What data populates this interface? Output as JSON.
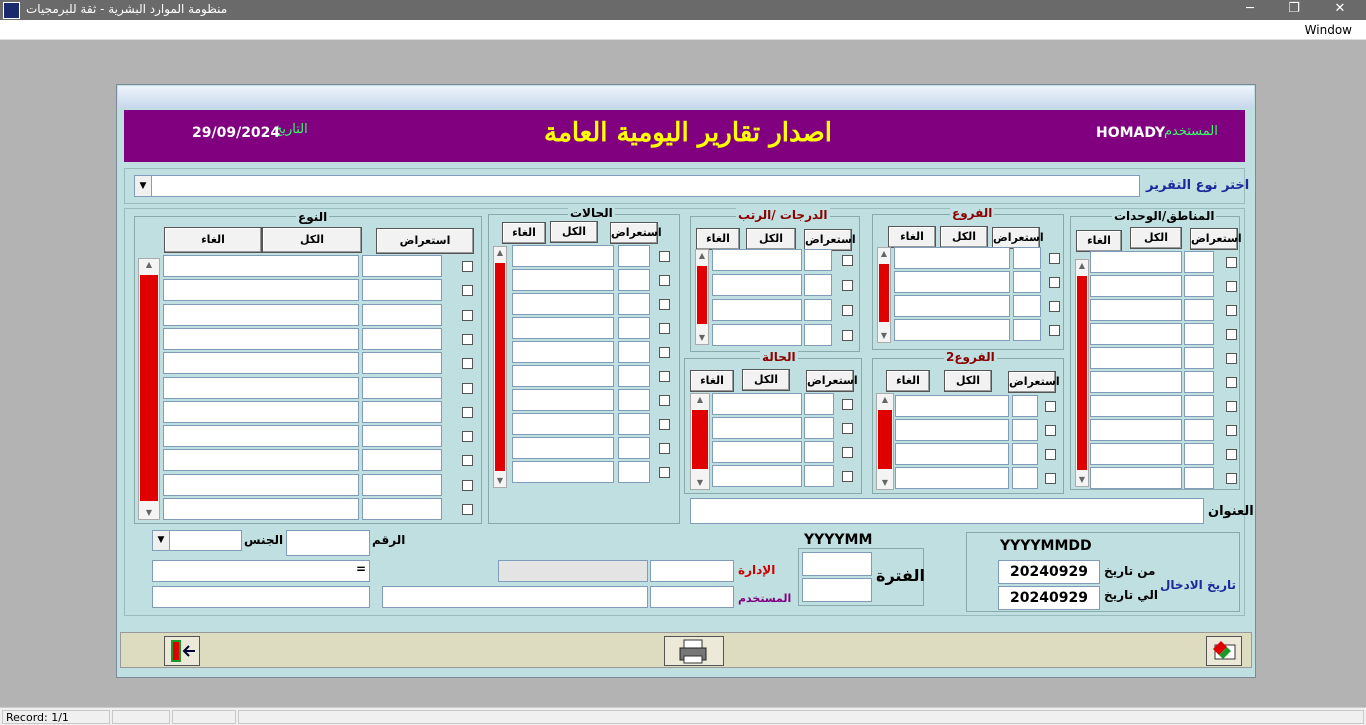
{
  "window": {
    "title": "منظومة الموارد البشرية - ثقة للبرمجيات",
    "minimize": "─",
    "restore": "❐",
    "close": "✕",
    "menu_window": "Window"
  },
  "header": {
    "title": "اصدار تقارير اليومية العامة",
    "user_label": "المستخدم",
    "user_value": "HOMADY",
    "date_label": "التاريخ",
    "date_value": "29/09/2024"
  },
  "report_select": {
    "label": "اختر نوع التقرير",
    "value": ""
  },
  "groups": {
    "regions": {
      "title": "المناطق/الوحدات",
      "browse": "استعراض",
      "all": "الكل",
      "cancel": "الغاء"
    },
    "branches": {
      "title": "الفروع",
      "browse": "استعراض",
      "all": "الكل",
      "cancel": "الغاء"
    },
    "grades": {
      "title": "الدرجات /الرتب",
      "browse": "استعراض",
      "all": "الكل",
      "cancel": "الغاء"
    },
    "cases": {
      "title": "الحالات",
      "browse": "استعراض",
      "all": "الكل",
      "cancel": "الغاء"
    },
    "type": {
      "title": "النوع",
      "browse": "استعراض",
      "all": "الكل",
      "cancel": "الغاء"
    },
    "branches2": {
      "title": "الفروع2",
      "browse": "استعراض",
      "all": "الكل",
      "cancel": "الغاء"
    },
    "status": {
      "title": "الحالة",
      "browse": "استعراض",
      "all": "الكل",
      "cancel": "الغاء"
    }
  },
  "address_label": "العنوان",
  "entry_dates": {
    "group_label": "تاريخ الادخال",
    "format": "YYYYMMDD",
    "from_label": "من تاريخ",
    "from_value": "20240929",
    "to_label": "الي تاريخ",
    "to_value": "20240929"
  },
  "period": {
    "label": "الفترة",
    "format": "YYYYMM"
  },
  "person": {
    "number_label": "الرقم",
    "gender_label": "الجنس",
    "equals": "=",
    "department_label": "الإدارة",
    "user_label": "المستخدم"
  },
  "statusbar": {
    "record": "Record: 1/1"
  },
  "colors": {
    "banner": "#800080",
    "title": "#ffff00",
    "scroll_thumb": "#e00000",
    "form_bg": "#c0dfe0"
  }
}
